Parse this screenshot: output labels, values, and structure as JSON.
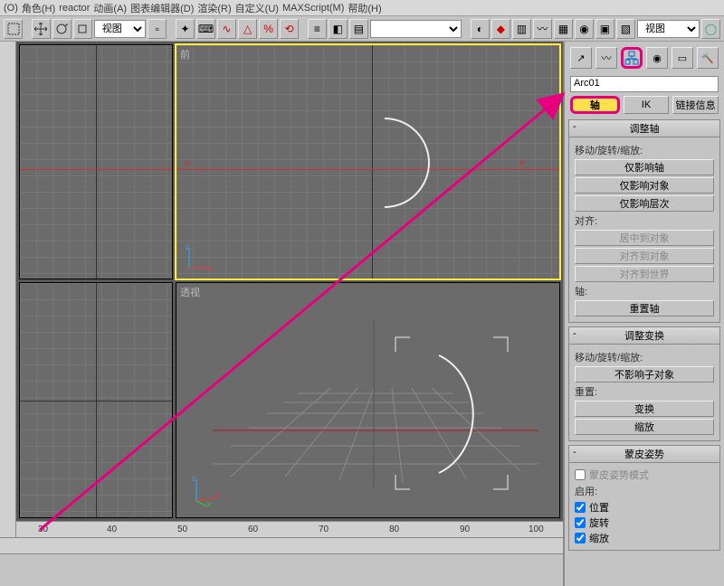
{
  "menu": {
    "o": "(O)",
    "role": "角色(H)",
    "reactor": "reactor",
    "anim": "动画(A)",
    "graph": "图表编辑器(D)",
    "render": "渲染(R)",
    "custom": "自定义(U)",
    "maxscript": "MAXScript(M)",
    "help": "帮助(H)"
  },
  "toolbar": {
    "view_dropdown": "视图",
    "view_dropdown2": "视图"
  },
  "viewports": {
    "tl": "",
    "tr": "前",
    "bl": "",
    "br": "透视",
    "axis_x": "x",
    "axis_y": "y",
    "axis_z": "z"
  },
  "ruler_ticks": [
    "30",
    "40",
    "50",
    "60",
    "70",
    "80",
    "90",
    "100"
  ],
  "panel": {
    "tabs": {
      "create": "create",
      "modify": "modify",
      "hierarchy": "hierarchy",
      "motion": "motion",
      "display": "display",
      "utilities": "utilities"
    },
    "object_name": "Arc01",
    "subtabs": {
      "pivot": "轴",
      "ik": "IK",
      "link": "链接信息"
    },
    "rollout_adjust_pivot": {
      "title": "调整轴",
      "move_group": "移动/旋转/缩放:",
      "btn_only_pivot": "仅影响轴",
      "btn_only_object": "仅影响对象",
      "btn_only_hier": "仅影响层次",
      "align_group": "对齐:",
      "btn_center_obj": "居中到对象",
      "btn_align_obj": "对齐到对象",
      "btn_align_world": "对齐到世界",
      "pivot_group": "轴:",
      "btn_reset_pivot": "重置轴"
    },
    "rollout_adjust_xform": {
      "title": "调整变换",
      "move_group": "移动/旋转/缩放:",
      "btn_no_child": "不影响子对象",
      "reset_group": "重置:",
      "btn_xform": "变换",
      "btn_scale": "缩放"
    },
    "rollout_skin_pose": {
      "title": "蒙皮姿势",
      "chk_mode": "蒙皮姿势模式",
      "enable_group": "启用:",
      "chk_pos": "位置",
      "chk_rot": "旋转",
      "chk_scale": "缩放"
    }
  }
}
